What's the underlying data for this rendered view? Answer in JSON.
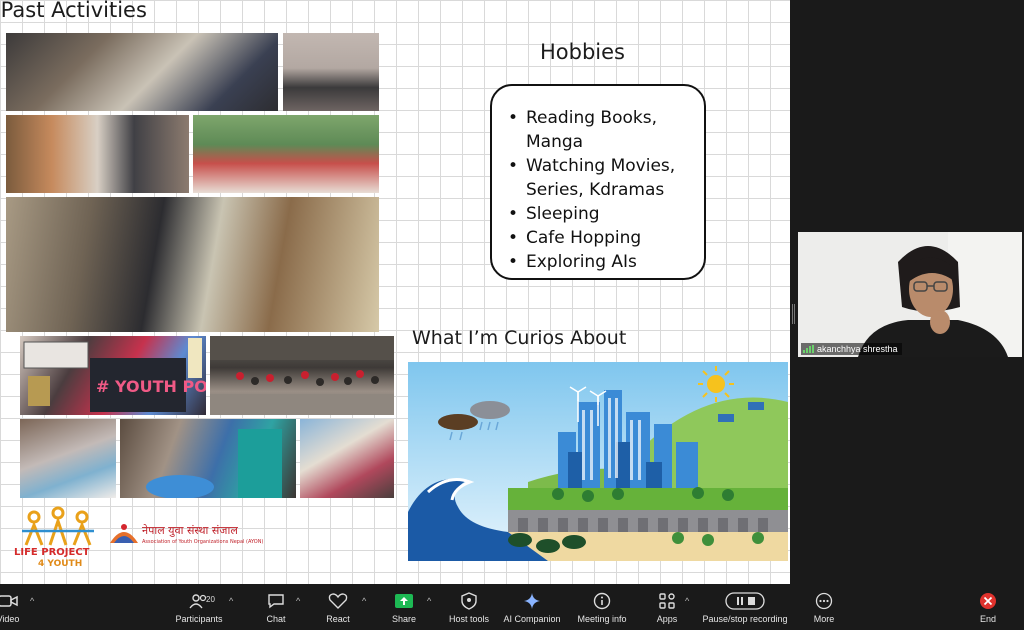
{
  "slide": {
    "past_title": "’Past Activities",
    "hobbies_title": "Hobbies",
    "hobbies": [
      "Reading Books,",
      "Manga",
      "Watching Movies,",
      "Series, Kdramas",
      "Sleeping",
      "Cafe Hopping",
      "Exploring AIs"
    ],
    "curious_title": "What I’m Curios About",
    "logos": {
      "life_project": "LIFE PROJECT",
      "life_project_sub": "4 YOUTH",
      "nepal_title": "नेपाल युवा संस्था संजाल",
      "nepal_sub": "Association of Youth Organizations Nepal (AYON)"
    },
    "photo_sign_text": "# YOUTH POWER"
  },
  "participant": {
    "name": "akanchhya shrestha"
  },
  "toolbar": {
    "video": "Video",
    "participants": "Participants",
    "participants_count": "20",
    "chat": "Chat",
    "react": "React",
    "share": "Share",
    "host_tools": "Host tools",
    "ai_companion": "AI Companion",
    "meeting_info": "Meeting info",
    "apps": "Apps",
    "recording": "Pause/stop recording",
    "more": "More",
    "end": "End"
  },
  "colors": {
    "share_green": "#1db954",
    "end_red": "#e0322d",
    "toolbar_bg": "#1a1a1a"
  }
}
